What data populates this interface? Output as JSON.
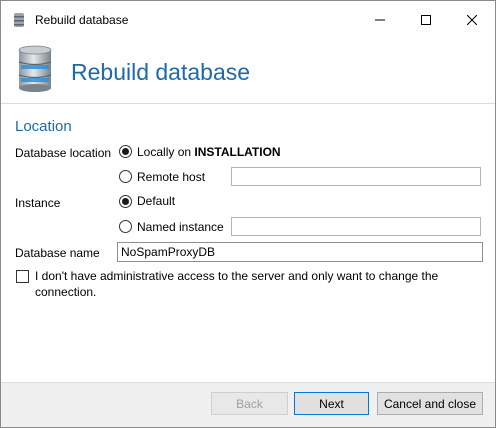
{
  "window": {
    "title": "Rebuild database"
  },
  "header": {
    "title": "Rebuild database"
  },
  "section": {
    "title": "Location"
  },
  "location": {
    "label": "Database location",
    "local_prefix": "Locally on",
    "local_host": "INSTALLATION",
    "remote_label": "Remote host",
    "remote_value": ""
  },
  "instance": {
    "label": "Instance",
    "default_label": "Default",
    "named_label": "Named instance",
    "named_value": ""
  },
  "database": {
    "label": "Database name",
    "value": "NoSpamProxyDB"
  },
  "access": {
    "label": "I don't have administrative access to the server and only want to change the connection.",
    "checked": false
  },
  "footer": {
    "back": "Back",
    "next": "Next",
    "cancel": "Cancel and close"
  },
  "colors": {
    "accent": "#1f6aa6",
    "focus_border": "#0078d7"
  }
}
